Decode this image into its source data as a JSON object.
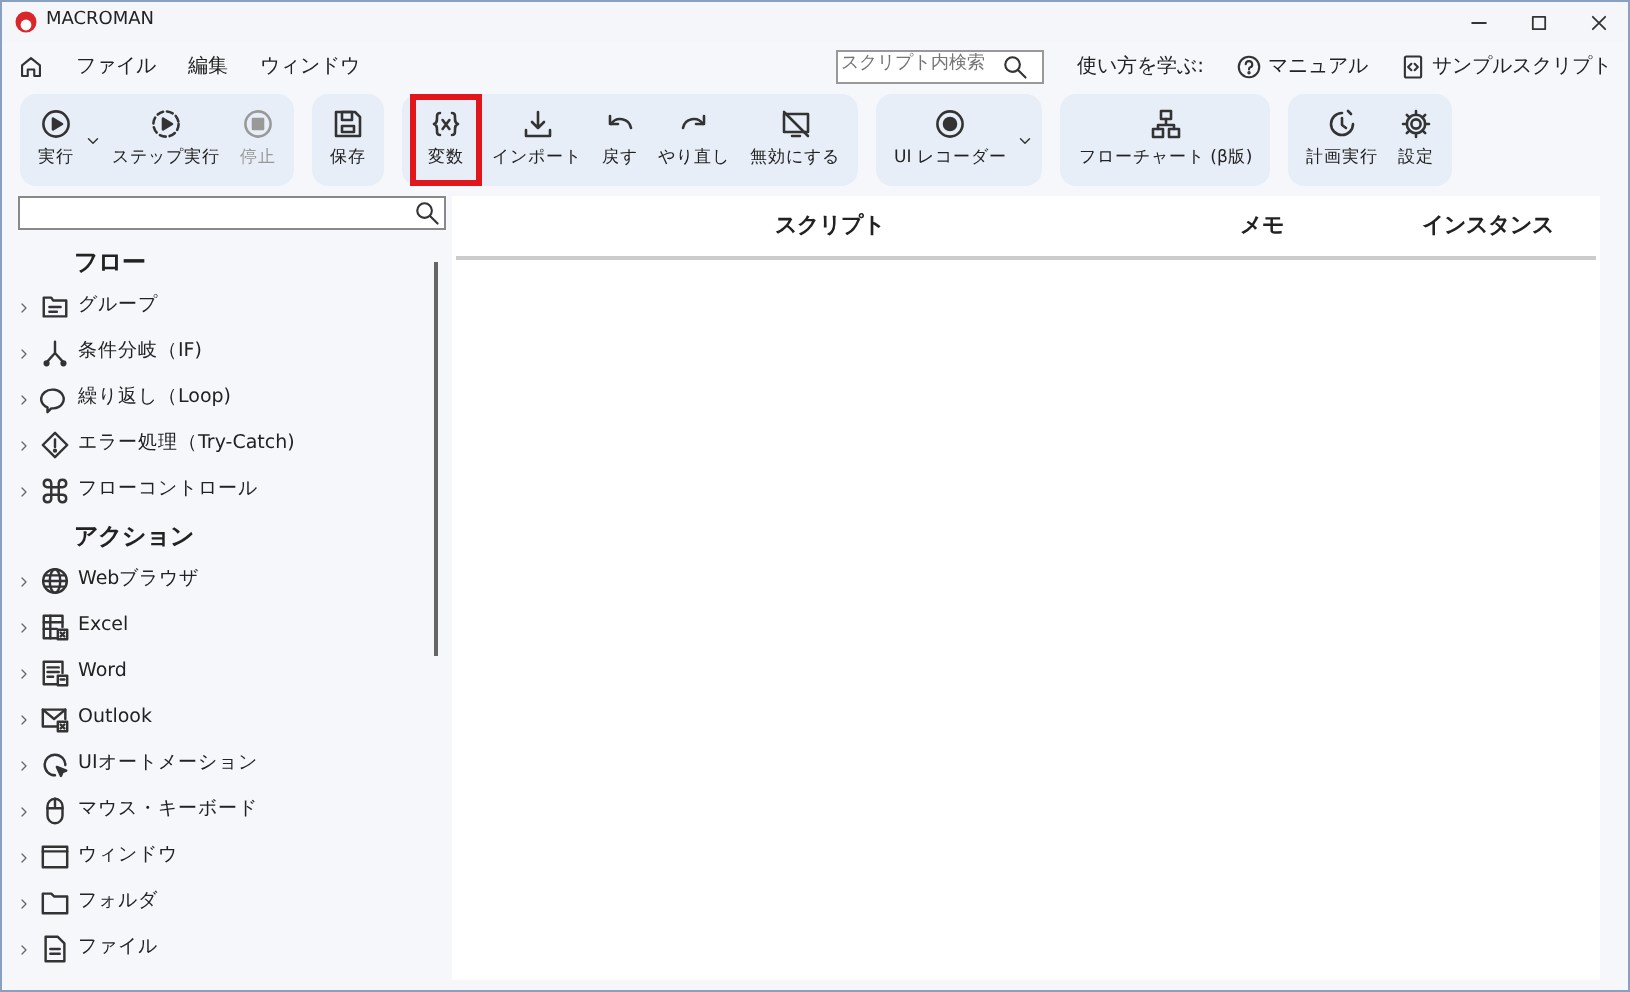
{
  "window": {
    "title": "MACROMAN"
  },
  "menu": [
    "ファイル",
    "編集",
    "ウィンドウ"
  ],
  "search": {
    "placeholder": "スクリプト内検索"
  },
  "help": {
    "label": "使い方を学ぶ:",
    "links": [
      "マニュアル",
      "サンプルスクリプト"
    ]
  },
  "toolbar": [
    {
      "items": [
        {
          "kind": "button",
          "label": "実行",
          "disabled": false,
          "highlighted": false
        },
        {
          "kind": "dropdown"
        },
        {
          "kind": "button",
          "label": "ステップ実行",
          "disabled": false,
          "highlighted": false
        },
        {
          "kind": "button",
          "label": "停止",
          "disabled": true,
          "highlighted": false
        }
      ]
    },
    {
      "items": [
        {
          "kind": "button",
          "label": "保存",
          "disabled": false,
          "highlighted": false
        }
      ]
    },
    {
      "items": [
        {
          "kind": "button",
          "label": "変数",
          "disabled": false,
          "highlighted": true
        },
        {
          "kind": "button",
          "label": "インポート",
          "disabled": false,
          "highlighted": false
        },
        {
          "kind": "button",
          "label": "戻す",
          "disabled": false,
          "highlighted": false
        },
        {
          "kind": "button",
          "label": "やり直し",
          "disabled": false,
          "highlighted": false
        },
        {
          "kind": "button",
          "label": "無効にする",
          "disabled": false,
          "highlighted": false
        }
      ]
    },
    {
      "items": [
        {
          "kind": "button",
          "label": "UI レコーダー",
          "disabled": false,
          "highlighted": false
        },
        {
          "kind": "dropdown"
        }
      ]
    },
    {
      "items": [
        {
          "kind": "button",
          "label": "フローチャート (β版)",
          "disabled": false,
          "highlighted": false
        }
      ]
    },
    {
      "items": [
        {
          "kind": "button",
          "label": "計画実行",
          "disabled": false,
          "highlighted": false
        },
        {
          "kind": "button",
          "label": "設定",
          "disabled": false,
          "highlighted": false
        }
      ]
    }
  ],
  "sidebar": {
    "sections": [
      {
        "heading": "フロー",
        "items": [
          {
            "label": "グループ",
            "expanded": false
          },
          {
            "label": "条件分岐（IF)",
            "expanded": false
          },
          {
            "label": "繰り返し（Loop)",
            "expanded": false
          },
          {
            "label": "エラー処理（Try-Catch)",
            "expanded": false
          },
          {
            "label": "フローコントロール",
            "expanded": false
          }
        ]
      },
      {
        "heading": "アクション",
        "items": [
          {
            "label": "Webブラウザ",
            "expanded": false
          },
          {
            "label": "Excel",
            "expanded": false
          },
          {
            "label": "Word",
            "expanded": false
          },
          {
            "label": "Outlook",
            "expanded": false
          },
          {
            "label": "UIオートメーション",
            "expanded": false
          },
          {
            "label": "マウス・キーボード",
            "expanded": false
          },
          {
            "label": "ウィンドウ",
            "expanded": false
          },
          {
            "label": "フォルダ",
            "expanded": false
          },
          {
            "label": "ファイル",
            "expanded": false
          }
        ]
      }
    ]
  },
  "table": {
    "columns": [
      "スクリプト",
      "メモ",
      "インスタンス"
    ]
  }
}
